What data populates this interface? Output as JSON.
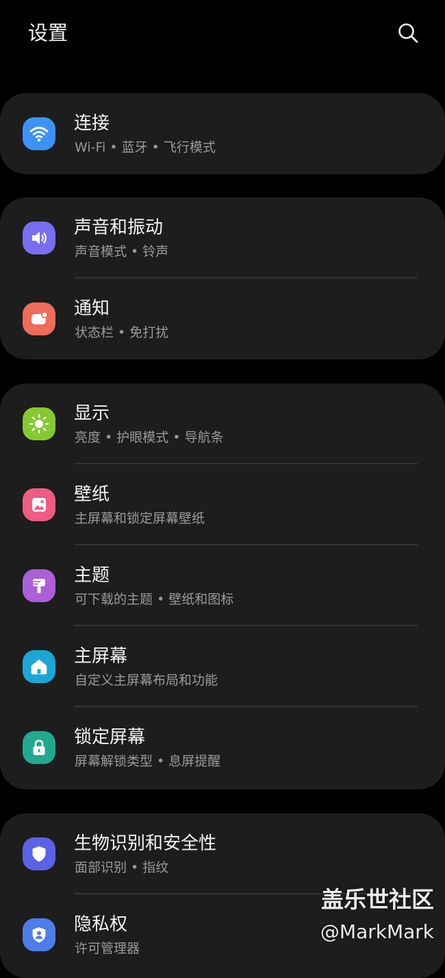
{
  "header": {
    "title": "设置",
    "search_icon": "search-icon"
  },
  "colors": {
    "background": "#000000",
    "card": "#1d1d1d",
    "title_text": "#f4f4f4",
    "subtitle_text": "#9a9a9a"
  },
  "groups": [
    {
      "items": [
        {
          "title": "连接",
          "subtitle": "Wi-Fi • 蓝牙 • 飞行模式",
          "icon": "wifi-icon",
          "icon_color": "#3d93f5"
        }
      ]
    },
    {
      "items": [
        {
          "title": "声音和振动",
          "subtitle": "声音模式 • 铃声",
          "icon": "volume-icon",
          "icon_color": "#7a6df0"
        },
        {
          "title": "通知",
          "subtitle": "状态栏 • 免打扰",
          "icon": "notification-icon",
          "icon_color": "#ef6b5b"
        }
      ]
    },
    {
      "items": [
        {
          "title": "显示",
          "subtitle": "亮度 • 护眼模式 • 导航条",
          "icon": "brightness-icon",
          "icon_color": "#86c832"
        },
        {
          "title": "壁纸",
          "subtitle": "主屏幕和锁定屏幕壁纸",
          "icon": "wallpaper-icon",
          "icon_color": "#ee5c86"
        },
        {
          "title": "主题",
          "subtitle": "可下载的主题 • 壁纸和图标",
          "icon": "theme-brush-icon",
          "icon_color": "#ab5fd8"
        },
        {
          "title": "主屏幕",
          "subtitle": "自定义主屏幕布局和功能",
          "icon": "home-icon",
          "icon_color": "#1ba6d6"
        },
        {
          "title": "锁定屏幕",
          "subtitle": "屏幕解锁类型 • 息屏提醒",
          "icon": "lock-icon",
          "icon_color": "#22a88e"
        }
      ]
    },
    {
      "items": [
        {
          "title": "生物识别和安全性",
          "subtitle": "面部识别 • 指纹",
          "icon": "shield-icon",
          "icon_color": "#5a62e6"
        },
        {
          "title": "隐私权",
          "subtitle": "许可管理器",
          "icon": "privacy-icon",
          "icon_color": "#4d7de8"
        }
      ]
    }
  ],
  "watermark": {
    "line1": "盖乐世社区",
    "line2": "@MarkMark"
  }
}
